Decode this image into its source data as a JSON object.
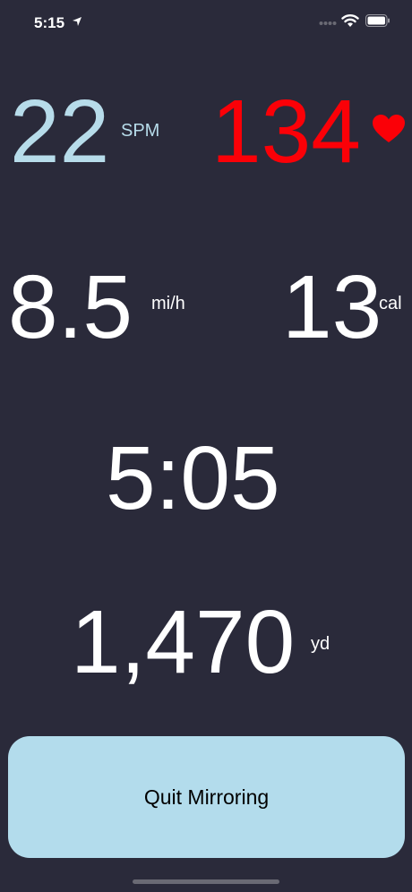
{
  "status_bar": {
    "time": "5:15",
    "icons": [
      "location-arrow-icon",
      "cellular-signal-icon",
      "wifi-icon",
      "battery-icon"
    ]
  },
  "metrics": {
    "stroke_rate": {
      "value": "22",
      "unit": "SPM",
      "color": "#b7dcea"
    },
    "heart_rate": {
      "value": "134",
      "icon": "heart-icon",
      "color": "#fb0007"
    },
    "speed": {
      "value": "8.5",
      "unit": "mi/h",
      "color": "#ffffff"
    },
    "calories": {
      "value": "13",
      "unit": "cal",
      "color": "#ffffff"
    },
    "elapsed_time": {
      "value": "5:05",
      "color": "#ffffff"
    },
    "distance": {
      "value": "1,470",
      "unit": "yd",
      "color": "#ffffff"
    }
  },
  "actions": {
    "quit_label": "Quit Mirroring",
    "button_color": "#b3dcec"
  },
  "theme": {
    "background": "#2a2a3a"
  }
}
